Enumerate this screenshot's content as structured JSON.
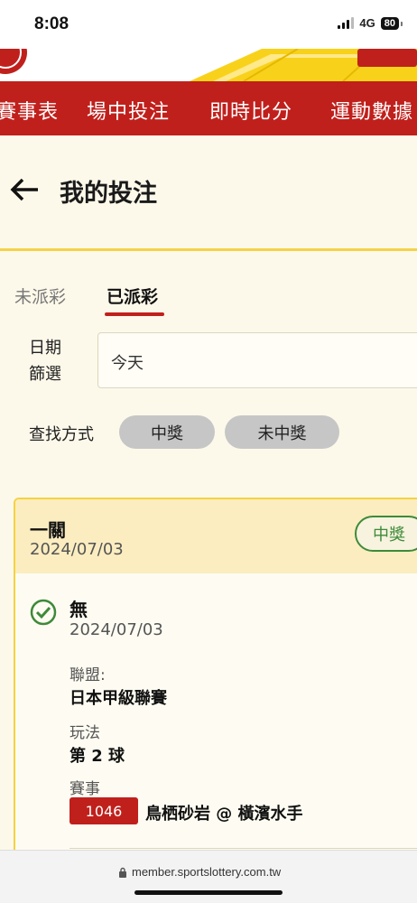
{
  "status_bar": {
    "time": "8:08",
    "network": "4G",
    "battery": "80"
  },
  "nav": {
    "items": [
      "賽事表",
      "場中投注",
      "即時比分",
      "運動數據"
    ]
  },
  "header": {
    "title": "我的投注"
  },
  "tabs": {
    "unpaid": "未派彩",
    "paid": "已派彩",
    "active": "paid"
  },
  "filter": {
    "date_label": "日期篩選",
    "date_value": "今天",
    "find_label": "查找方式",
    "chips": [
      "中獎",
      "未中獎"
    ]
  },
  "bet_card": {
    "type": "一關",
    "date": "2024/07/03",
    "result": "中獎",
    "selection": {
      "name": "無",
      "date": "2024/07/03",
      "league_label": "聯盟:",
      "league_value": "日本甲級聯賽",
      "play_label": "玩法",
      "play_value": "第 2 球",
      "event_label": "賽事",
      "match_code": "1046",
      "match_teams": "鳥栖砂岩 @ 橫濱水手"
    }
  },
  "browser": {
    "url": "member.sportslottery.com.tw"
  },
  "colors": {
    "brand_red": "#c0201c",
    "accent_yellow": "#f5d23f",
    "win_green": "#3e8a3a"
  }
}
